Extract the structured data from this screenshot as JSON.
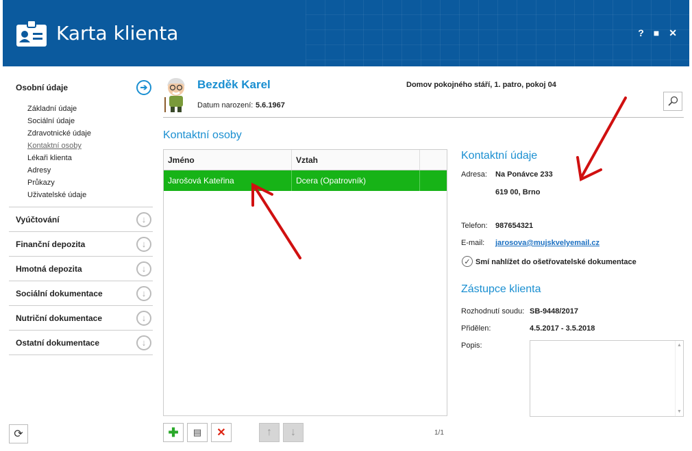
{
  "window": {
    "title": "Karta klienta",
    "controls": {
      "help": "?",
      "maximize": "■",
      "close": "✕"
    }
  },
  "sidebar": {
    "active_section": "Osobní údaje",
    "sub_items": [
      "Základní údaje",
      "Sociální údaje",
      "Zdravotnické údaje",
      "Kontaktní osoby",
      "Lékaři klienta",
      "Adresy",
      "Průkazy",
      "Uživatelské údaje"
    ],
    "selected_sub_item": "Kontaktní osoby",
    "sections": [
      "Vyúčtování",
      "Finanční depozita",
      "Hmotná depozita",
      "Sociální dokumentace",
      "Nutriční dokumentace",
      "Ostatní dokumentace"
    ]
  },
  "client": {
    "name": "Bezděk Karel",
    "dob_label": "Datum narození:",
    "dob": "5.6.1967",
    "facility": "Domov pokojného stáří, 1. patro, pokoj 04"
  },
  "contacts": {
    "title": "Kontaktní osoby",
    "columns": [
      "Jméno",
      "Vztah"
    ],
    "rows": [
      {
        "name": "Jarošová Kateřina",
        "relation": "Dcera (Opatrovník)"
      }
    ],
    "pager": "1/1"
  },
  "contact_details": {
    "title": "Kontaktní údaje",
    "address_label": "Adresa:",
    "address_line1": "Na Ponávce 233",
    "address_line2": "619 00, Brno",
    "phone_label": "Telefon:",
    "phone": "987654321",
    "email_label": "E-mail:",
    "email": "jarosova@mujskvelyemail.cz",
    "permission": "Smí nahlížet do ošetřovatelské dokumentace"
  },
  "representative": {
    "title": "Zástupce klienta",
    "decision_label": "Rozhodnutí soudu:",
    "decision": "SB-9448/2017",
    "assigned_label": "Přidělen:",
    "assigned": "4.5.2017 - 3.5.2018",
    "note_label": "Popis:"
  },
  "colors": {
    "titlebar": "#0b5a9e",
    "accent": "#1a8fd1",
    "selected_row": "#17b317",
    "annotation_arrow": "#d01010"
  }
}
